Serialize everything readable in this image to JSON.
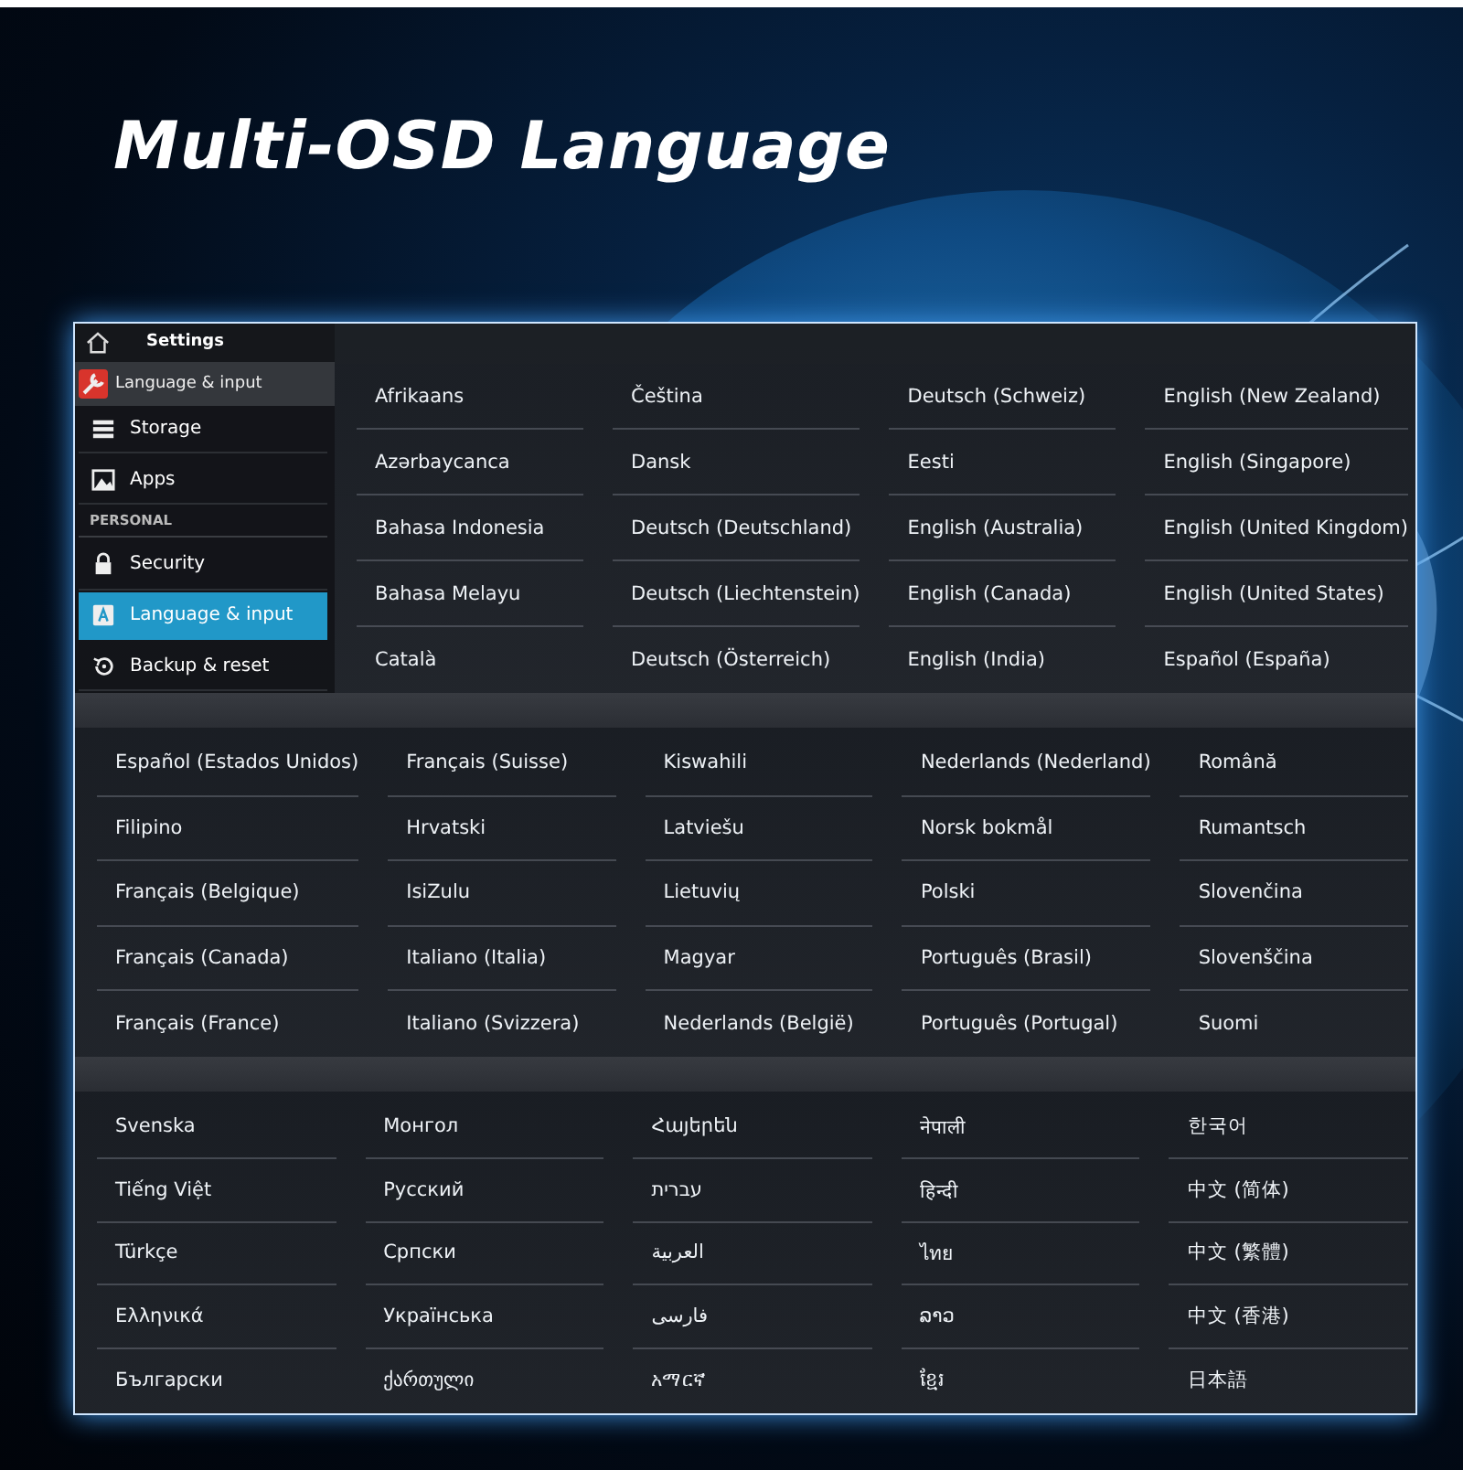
{
  "title": "Multi-OSD Language",
  "settings": {
    "header": "Settings",
    "app_bar": "Language & input",
    "items": [
      {
        "kind": "item",
        "label": "Storage",
        "selected": false
      },
      {
        "kind": "item",
        "label": "Apps",
        "selected": false
      },
      {
        "kind": "section",
        "label": "PERSONAL"
      },
      {
        "kind": "item",
        "label": "Security",
        "selected": false
      },
      {
        "kind": "item",
        "label": "Language & input",
        "selected": true
      },
      {
        "kind": "item",
        "label": "Backup & reset",
        "selected": false
      }
    ]
  },
  "language_panels": [
    {
      "columns": [
        [
          "Afrikaans",
          "Azərbaycanca",
          "Bahasa Indonesia",
          "Bahasa Melayu",
          "Català"
        ],
        [
          "Čeština",
          "Dansk",
          "Deutsch (Deutschland)",
          "Deutsch (Liechtenstein)",
          "Deutsch (Österreich)"
        ],
        [
          "Deutsch (Schweiz)",
          "Eesti",
          "English (Australia)",
          "English (Canada)",
          "English (India)"
        ],
        [
          "English (New Zealand)",
          "English (Singapore)",
          "English (United Kingdom)",
          "English (United States)",
          "Español (España)"
        ]
      ]
    },
    {
      "columns": [
        [
          "Español (Estados Unidos)",
          "Filipino",
          "Français (Belgique)",
          "Français (Canada)",
          "Français (France)"
        ],
        [
          "Français (Suisse)",
          "Hrvatski",
          "IsiZulu",
          "Italiano (Italia)",
          "Italiano (Svizzera)"
        ],
        [
          "Kiswahili",
          "Latviešu",
          "Lietuvių",
          "Magyar",
          "Nederlands (België)"
        ],
        [
          "Nederlands (Nederland)",
          "Norsk bokmål",
          "Polski",
          "Português (Brasil)",
          "Português (Portugal)"
        ],
        [
          "Română",
          "Rumantsch",
          "Slovenčina",
          "Slovenščina",
          "Suomi"
        ]
      ]
    },
    {
      "columns": [
        [
          "Svenska",
          "Tiếng Việt",
          "Türkçe",
          "Ελληνικά",
          "Български"
        ],
        [
          "Монгол",
          "Русский",
          "Српски",
          "Українська",
          "ქართული"
        ],
        [
          "Հայերեն",
          "עברית",
          "العربية",
          "فارسی",
          "አማርኛ"
        ],
        [
          "नेपाली",
          "हिन्दी",
          "ไทย",
          "ລາວ",
          "ខ្មែរ"
        ],
        [
          "한국어",
          "中文 (简体)",
          "中文 (繁體)",
          "中文 (香港)",
          "日本語"
        ]
      ]
    }
  ]
}
